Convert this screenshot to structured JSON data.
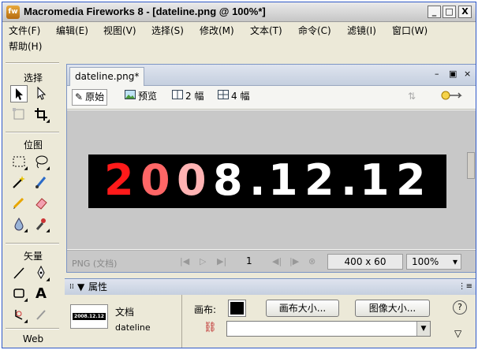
{
  "window": {
    "title": "Macromedia Fireworks 8 - [dateline.png @ 100%*]",
    "app_icon_text": "fw",
    "controls": {
      "minimize": "_",
      "maximize": "□",
      "close": "X"
    }
  },
  "menubar": {
    "items": [
      "文件(F)",
      "编辑(E)",
      "视图(V)",
      "选择(S)",
      "修改(M)",
      "文本(T)",
      "命令(C)",
      "滤镜(I)",
      "窗口(W)",
      "帮助(H)"
    ]
  },
  "tools": {
    "sections": {
      "select": "选择",
      "bitmap": "位图",
      "vector": "矢量",
      "web": "Web"
    },
    "text_tool_glyph": "A"
  },
  "document": {
    "tab_label": "dateline.png*",
    "controls": {
      "minimize": "–",
      "restore": "▣",
      "close": "×"
    },
    "view_buttons": [
      {
        "label": "原始"
      },
      {
        "label": "预览"
      },
      {
        "label": "2 幅"
      },
      {
        "label": "4 幅"
      }
    ],
    "canvas_image": {
      "chars": [
        "2",
        "0",
        "0",
        "8",
        ".",
        "1",
        "2",
        ".",
        "1",
        "2"
      ]
    },
    "status": {
      "file_label": "PNG (文档)",
      "frame": "1",
      "size": "400 x 60",
      "zoom": "100%",
      "zoom_arrow": "▾"
    }
  },
  "properties": {
    "title": "属性",
    "doc_type": "文档",
    "doc_name": "dateline",
    "canvas_label": "画布:",
    "canvas_size_button": "画布大小...",
    "image_size_button": "图像大小...",
    "help_icon": "?",
    "thumb_text": "2008.12.12"
  },
  "colors": {
    "canvas_fill": "#000000",
    "gradient_start": "#ff1a1a",
    "gradient_end": "#ffffff"
  }
}
